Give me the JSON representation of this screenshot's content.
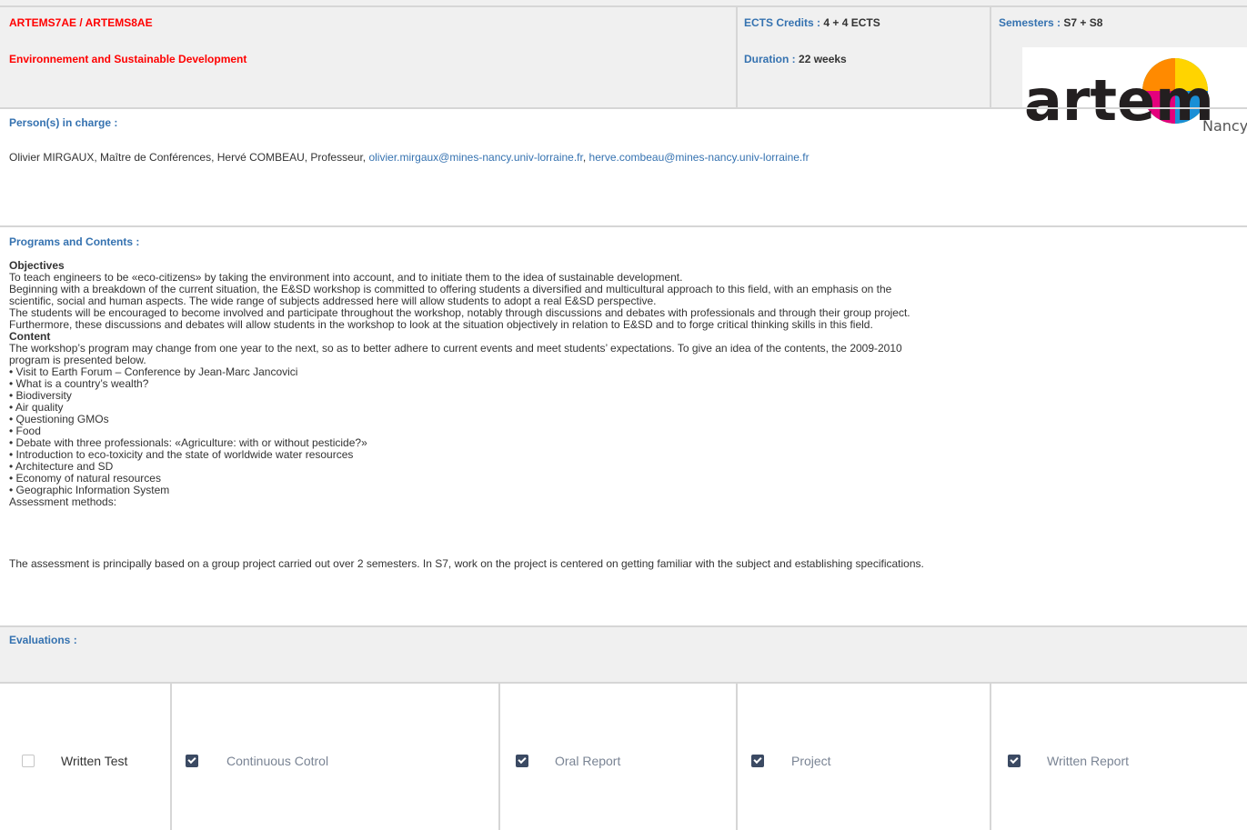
{
  "header": {
    "code": "ARTEMS7AE / ARTEMS8AE",
    "title": "Environnement and Sustainable Development",
    "ects_label": "ECTS Credits :",
    "ects_value": "4 + 4 ECTS",
    "duration_label": "Duration :",
    "duration_value": "22 weeks",
    "semesters_label": "Semesters :",
    "semesters_value": "S7 + S8",
    "logo_text": "artem",
    "logo_sub": "Nancy"
  },
  "persons": {
    "heading": "Person(s) in charge :",
    "names": "Olivier MIRGAUX, Maître de Conférences, Hervé COMBEAU, Professeur,",
    "email1": "olivier.mirgaux@mines-nancy.univ-lorraine.fr",
    "email2": "herve.combeau@mines-nancy.univ-lorraine.fr"
  },
  "programs": {
    "heading": "Programs and Contents :",
    "objectives_title": "Objectives",
    "objectives": [
      "To teach engineers to be «eco-citizens» by taking the environment into account, and to initiate them to the idea of sustainable development.",
      "Beginning with a breakdown of the current situation, the E&SD workshop is committed to offering students a diversified and multicultural approach to this field, with an emphasis on the",
      "scientific, social and human aspects. The wide range of subjects addressed here will allow students to adopt a real E&SD perspective.",
      "The students will be encouraged to become involved and participate throughout the workshop, notably through discussions and debates with professionals and through their group project.",
      "Furthermore, these discussions and debates will allow students in the workshop to look at the situation objectively in relation to E&SD and to forge critical thinking skills in this field."
    ],
    "content_title": "Content",
    "content_intro": [
      "The workshop’s program may change from one year to the next, so as to better adhere to current events and meet students’ expectations. To give an idea of the contents, the 2009-2010",
      "program is presented below."
    ],
    "items": [
      "• Visit to Earth Forum – Conference by Jean-Marc Jancovici",
      "• What is a country’s wealth?",
      "• Biodiversity",
      "• Air quality",
      "• Questioning GMOs",
      "• Food",
      "• Debate with three professionals: «Agriculture: with or without pesticide?»",
      "• Introduction to eco-toxicity and the state of worldwide water resources",
      "• Architecture and SD",
      "• Economy of natural resources",
      "• Geographic Information System"
    ],
    "assessment_title": "Assessment methods:",
    "assessment_text": "The assessment is principally based on a group project carried out over 2 semesters. In S7, work on the project is centered on getting familiar with the subject and establishing specifications."
  },
  "evaluations": {
    "heading": "Evaluations :",
    "options": [
      {
        "label": "Written Test",
        "checked": false
      },
      {
        "label": "Continuous Cotrol",
        "checked": true
      },
      {
        "label": "Oral Report",
        "checked": true
      },
      {
        "label": "Project",
        "checked": true
      },
      {
        "label": "Written Report",
        "checked": true
      }
    ]
  },
  "colors": {
    "accent_red": "#ff0000",
    "label_blue": "#3572b0",
    "section_gray": "#f0f0f0",
    "checkbox_dark": "#3b4a63",
    "logo_dark": "#231f20"
  }
}
